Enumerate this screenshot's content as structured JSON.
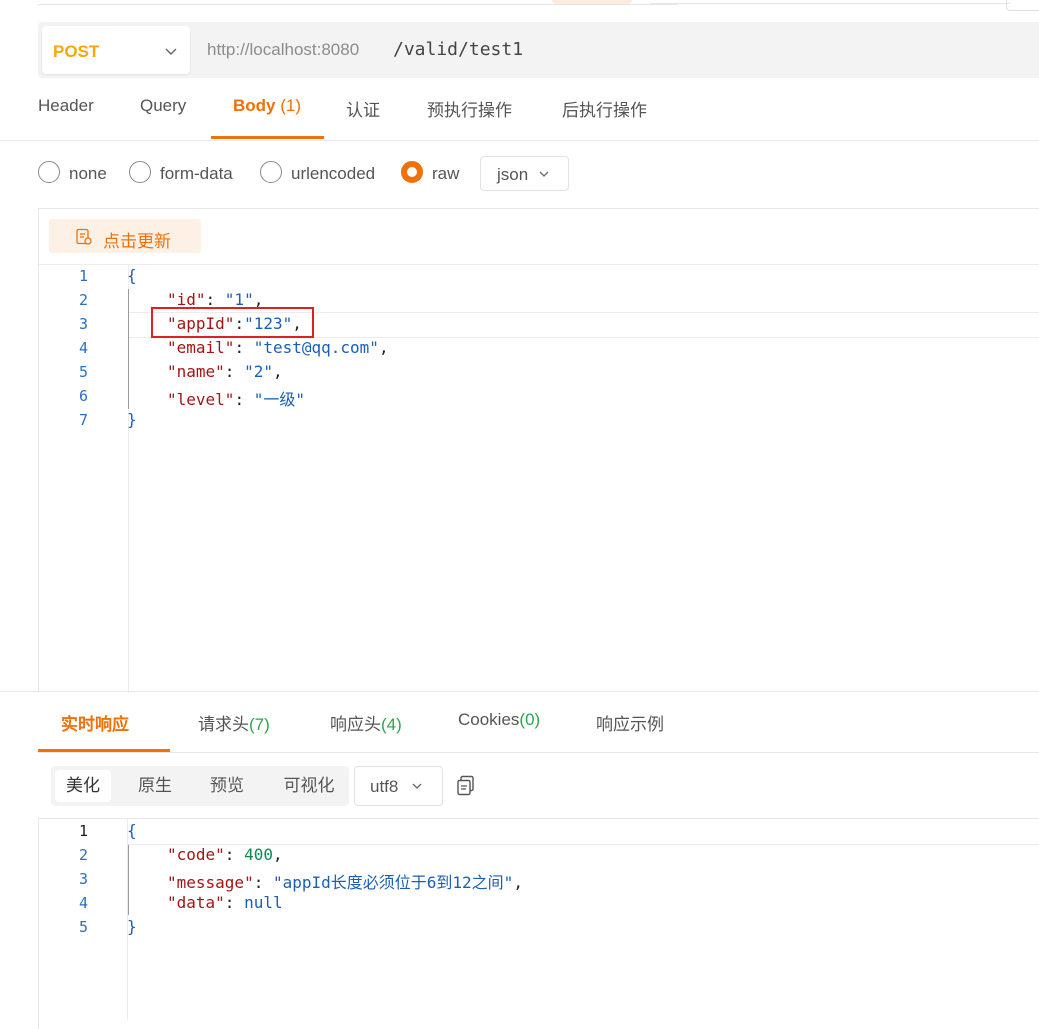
{
  "request": {
    "method": "POST",
    "base_url": "http://localhost:8080",
    "path": "/valid/test1"
  },
  "request_tabs": [
    {
      "label": "Header"
    },
    {
      "label": "Query"
    },
    {
      "label": "Body",
      "count": "(1)"
    },
    {
      "label": "认证"
    },
    {
      "label": "预执行操作"
    },
    {
      "label": "后执行操作"
    }
  ],
  "body_types": [
    "none",
    "form-data",
    "urlencoded",
    "raw"
  ],
  "body_selected": "raw",
  "body_format": "json",
  "refresh_label": "点击更新",
  "request_body": {
    "line_numbers": [
      "1",
      "2",
      "3",
      "4",
      "5",
      "6",
      "7"
    ],
    "open": "{",
    "close": "}",
    "fields": [
      {
        "key": "\"id\"",
        "sep": ": ",
        "value": "\"1\"",
        "end": ","
      },
      {
        "key": "\"appId\"",
        "sep": ":",
        "value": "\"123\"",
        "end": ","
      },
      {
        "key": "\"email\"",
        "sep": ": ",
        "value": "\"test@qq.com\"",
        "end": ","
      },
      {
        "key": "\"name\"",
        "sep": ": ",
        "value": "\"2\"",
        "end": ","
      },
      {
        "key": "\"level\"",
        "sep": ": ",
        "value": "\"一级\"",
        "end": ""
      }
    ]
  },
  "response_tabs": [
    {
      "label": "实时响应"
    },
    {
      "label": "请求头",
      "count": "(7)"
    },
    {
      "label": "响应头",
      "count": "(4)"
    },
    {
      "label": "Cookies",
      "count": "(0)"
    },
    {
      "label": "响应示例"
    }
  ],
  "view_modes": [
    "美化",
    "原生",
    "预览",
    "可视化"
  ],
  "encoding": "utf8",
  "response_body": {
    "line_numbers": [
      "1",
      "2",
      "3",
      "4",
      "5"
    ],
    "open": "{",
    "close": "}",
    "fields": [
      {
        "key": "\"code\"",
        "sep": ": ",
        "value": "400",
        "end": ","
      },
      {
        "key": "\"message\"",
        "sep": ": ",
        "value": "\"appId长度必须位于6到12之间\"",
        "end": ","
      },
      {
        "key": "\"data\"",
        "sep": ": ",
        "value": "null",
        "end": ""
      }
    ]
  },
  "colors": {
    "accent": "#f0700a",
    "method": "#f8a70b",
    "highlight_box": "#e02020",
    "count_green": "#2aa84a"
  }
}
